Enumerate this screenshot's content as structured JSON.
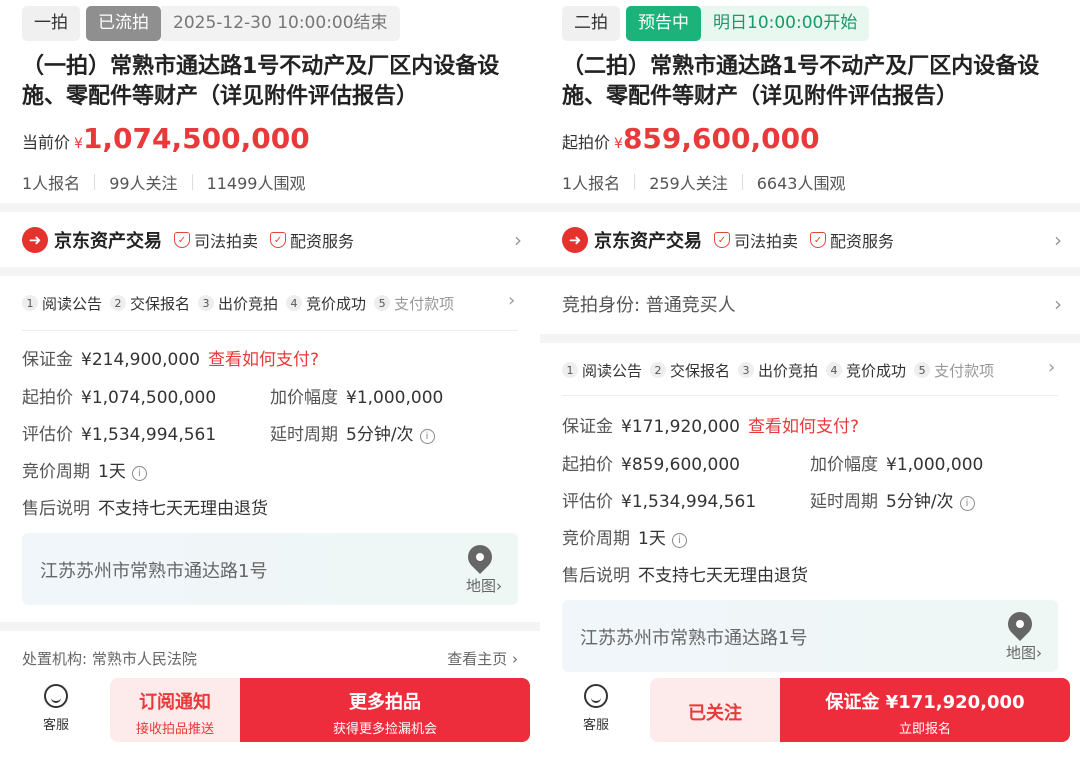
{
  "left": {
    "tag_round": "一拍",
    "tag_status": "已流拍",
    "tag_time": "2025-12-30 10:00:00结束",
    "title": "（一拍）常熟市通达路1号不动产及厂区内设备设施、零配件等财产（详见附件评估报告）",
    "price_label": "当前价",
    "currency": "¥",
    "price": "1,074,500,000",
    "stats": [
      "1人报名",
      "99人关注",
      "11499人围观"
    ],
    "brand": {
      "name": "京东资产交易",
      "badges": [
        "司法拍卖",
        "配资服务"
      ]
    },
    "steps": [
      {
        "num": "1",
        "label": "阅读公告"
      },
      {
        "num": "2",
        "label": "交保报名"
      },
      {
        "num": "3",
        "label": "出价竞拍"
      },
      {
        "num": "4",
        "label": "竞价成功"
      },
      {
        "num": "5",
        "label": "支付款项"
      }
    ],
    "deposit_label": "保证金",
    "deposit_value": "¥214,900,000",
    "deposit_link": "查看如何支付?",
    "start_label": "起拍价",
    "start_value": "¥1,074,500,000",
    "increment_label": "加价幅度",
    "increment_value": "¥1,000,000",
    "appraisal_label": "评估价",
    "appraisal_value": "¥1,534,994,561",
    "delay_label": "延时周期",
    "delay_value": "5分钟/次",
    "cycle_label": "竞价周期",
    "cycle_value": "1天",
    "aftersale_label": "售后说明",
    "aftersale_value": "不支持七天无理由退货",
    "address": "江苏苏州市常熟市通达路1号",
    "map_label": "地图",
    "agency": "处置机构: 常熟市人民法院",
    "agency_link": "查看主页",
    "cs_label": "客服",
    "btn_light_main": "订阅通知",
    "btn_light_sub": "接收拍品推送",
    "btn_red_main": "更多拍品",
    "btn_red_sub": "获得更多捡漏机会"
  },
  "right": {
    "tag_round": "二拍",
    "tag_status": "预告中",
    "tag_time": "明日10:00:00开始",
    "title": "（二拍）常熟市通达路1号不动产及厂区内设备设施、零配件等财产（详见附件评估报告）",
    "price_label": "起拍价",
    "currency": "¥",
    "price": "859,600,000",
    "stats": [
      "1人报名",
      "259人关注",
      "6643人围观"
    ],
    "brand": {
      "name": "京东资产交易",
      "badges": [
        "司法拍卖",
        "配资服务"
      ]
    },
    "identity": "竞拍身份: 普通竞买人",
    "steps": [
      {
        "num": "1",
        "label": "阅读公告"
      },
      {
        "num": "2",
        "label": "交保报名"
      },
      {
        "num": "3",
        "label": "出价竞拍"
      },
      {
        "num": "4",
        "label": "竞价成功"
      },
      {
        "num": "5",
        "label": "支付款项"
      }
    ],
    "deposit_label": "保证金",
    "deposit_value": "¥171,920,000",
    "deposit_link": "查看如何支付?",
    "start_label": "起拍价",
    "start_value": "¥859,600,000",
    "increment_label": "加价幅度",
    "increment_value": "¥1,000,000",
    "appraisal_label": "评估价",
    "appraisal_value": "¥1,534,994,561",
    "delay_label": "延时周期",
    "delay_value": "5分钟/次",
    "cycle_label": "竞价周期",
    "cycle_value": "1天",
    "aftersale_label": "售后说明",
    "aftersale_value": "不支持七天无理由退货",
    "address": "江苏苏州市常熟市通达路1号",
    "map_label": "地图",
    "cs_label": "客服",
    "btn_light_main": "已关注",
    "btn_red_main": "保证金 ¥171,920,000",
    "btn_red_sub": "立即报名"
  },
  "colors": {
    "accent_red": "#e83a3a",
    "button_red": "#ee2d3c",
    "status_green": "#1bb37a"
  }
}
